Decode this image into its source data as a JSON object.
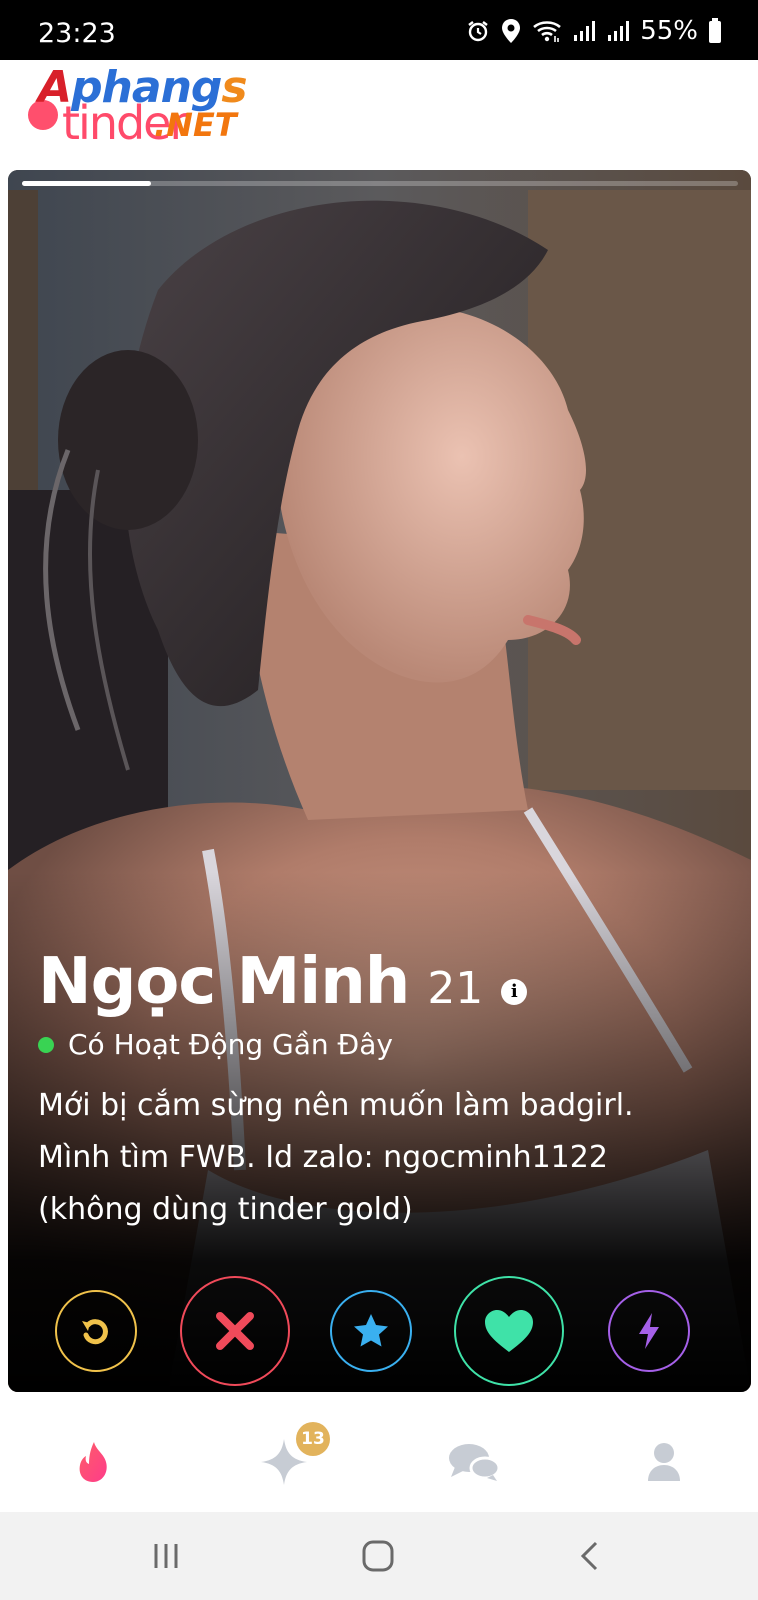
{
  "status_bar": {
    "time": "23:23",
    "battery": "55%",
    "icons": [
      "alarm-icon",
      "location-icon",
      "wifi-icon",
      "signal-icon",
      "signal-icon",
      "battery-icon"
    ]
  },
  "logo": {
    "line1": "Aphangs",
    "line2": "tinder",
    "suffix": ".NET",
    "colors": {
      "red": "#d8202a",
      "blue": "#2b6fd6",
      "orange": "#f08a1c",
      "pink": "#ff4a6a"
    }
  },
  "profile": {
    "name": "Ngọc Minh",
    "age": "21",
    "info_icon": "i",
    "active_status": "Có Hoạt Động Gần Đây",
    "bio_lines": [
      "Mới bị cắm sừng nên muốn làm badgirl.",
      "Mình tìm FWB. Id zalo: ngocminh1122",
      "(không dùng tinder gold)"
    ],
    "photo_progress": 0.18
  },
  "actions": [
    {
      "name": "rewind",
      "icon": "rewind-icon",
      "color": "#f0c24b"
    },
    {
      "name": "nope",
      "icon": "close-icon",
      "color": "#f04a5a"
    },
    {
      "name": "super-like",
      "icon": "star-icon",
      "color": "#3ab0f0"
    },
    {
      "name": "like",
      "icon": "heart-icon",
      "color": "#3fe2a8"
    },
    {
      "name": "boost",
      "icon": "lightning-icon",
      "color": "#a560e8"
    }
  ],
  "bottom_nav": {
    "items": [
      "flame-icon",
      "sparkle-icon",
      "chat-icon",
      "profile-icon"
    ],
    "badge": "13"
  },
  "system_nav": [
    "recents-icon",
    "home-icon",
    "back-icon"
  ]
}
